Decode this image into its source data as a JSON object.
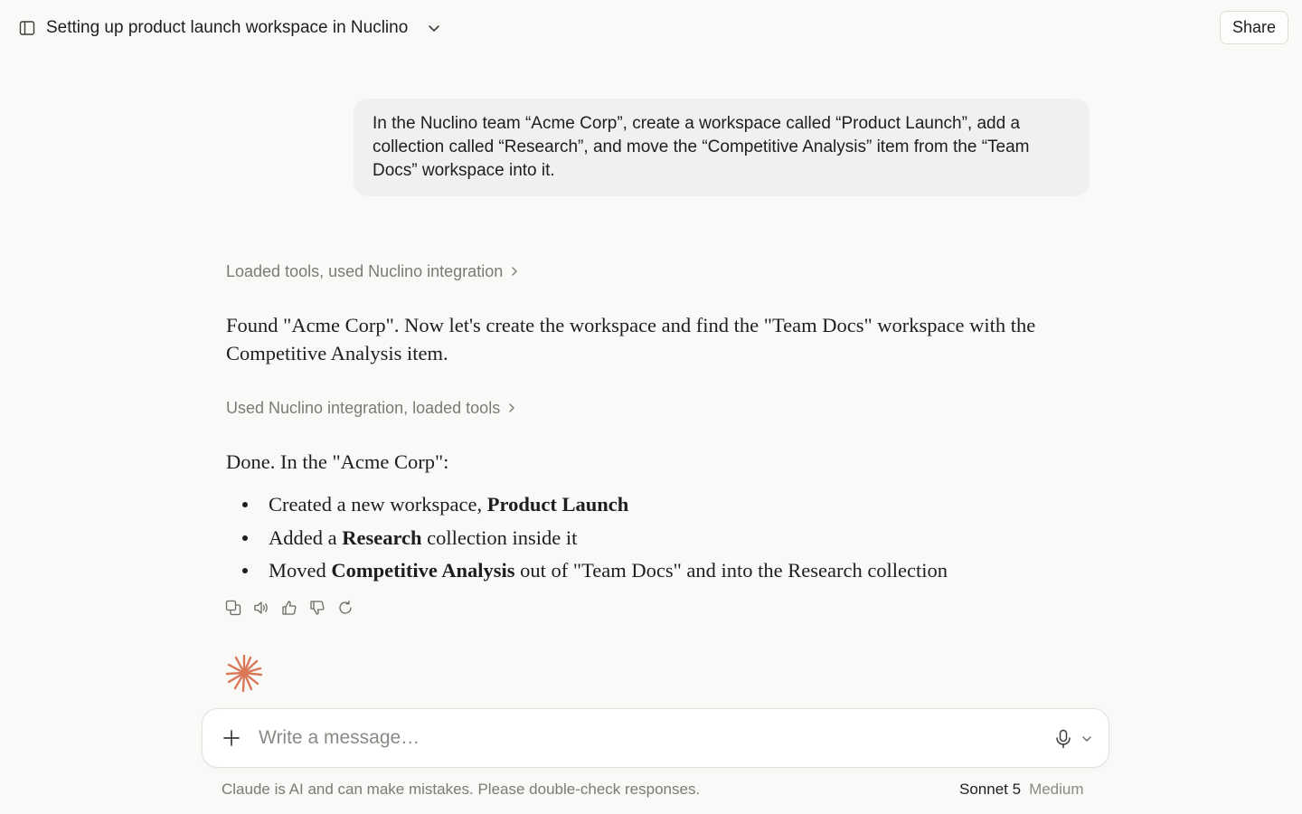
{
  "header": {
    "title": "Setting up product launch workspace in Nuclino",
    "share_label": "Share"
  },
  "user_message": {
    "text": "In the Nuclino team “Acme Corp”, create a workspace called “Product Launch”, add a collection called “Research”, and move the “Competitive Analysis” item from the “Team Docs” workspace into it."
  },
  "tool_rows": [
    {
      "label": "Loaded tools, used Nuclino integration"
    },
    {
      "label": "Used Nuclino integration, loaded tools"
    }
  ],
  "assistant": {
    "para1": "Found \"Acme Corp\". Now let's create the workspace and find the \"Team Docs\" workspace with the Competitive Analysis item.",
    "para2": "Done. In the \"Acme Corp\":",
    "bullets": [
      {
        "pre": "Created a new workspace, ",
        "bold": "Product Launch",
        "post": ""
      },
      {
        "pre": "Added a ",
        "bold": "Research",
        "post": " collection inside it"
      },
      {
        "pre": "Moved ",
        "bold": "Competitive Analysis",
        "post": " out of \"Team Docs\" and into the Research collection"
      }
    ],
    "action_icons": [
      "copy-icon",
      "speaker-icon",
      "thumbs-up-icon",
      "thumbs-down-icon",
      "retry-icon"
    ]
  },
  "composer": {
    "placeholder": "Write a message…",
    "disclaimer": "Claude is AI and can make mistakes. Please double-check responses.",
    "model_name": "Sonnet 5",
    "model_effort": "Medium"
  },
  "colors": {
    "background": "#f9f9f8",
    "user_bubble": "#f0f0ee",
    "muted_text": "#7b7a76",
    "brand_accent": "#d97757"
  }
}
